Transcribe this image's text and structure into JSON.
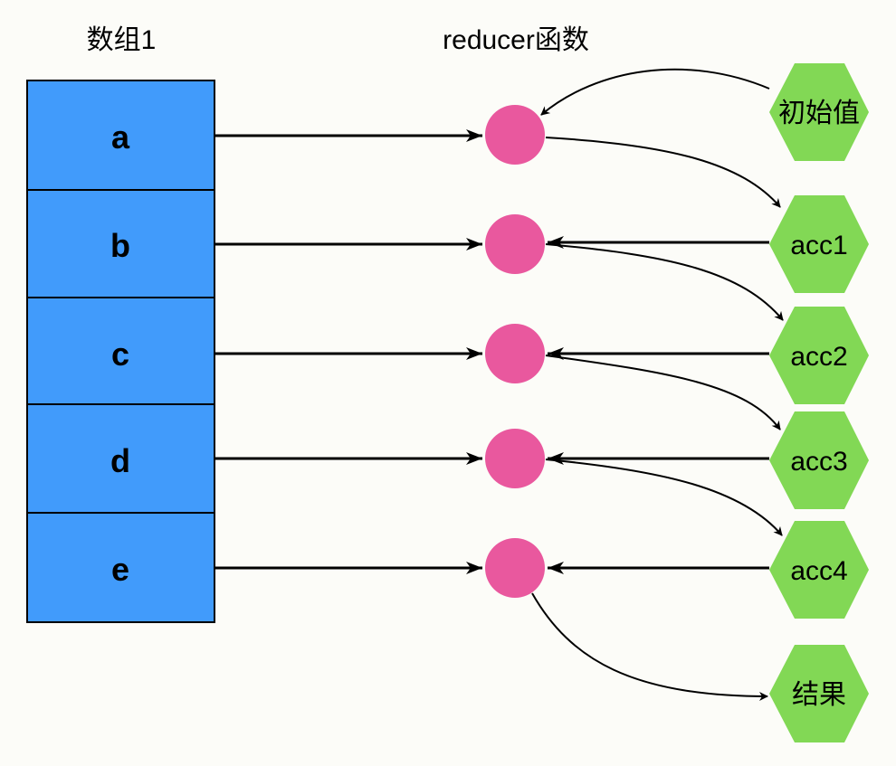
{
  "title_array": "数组1",
  "title_reducer": "reducer函数",
  "cells": [
    "a",
    "b",
    "c",
    "d",
    "e"
  ],
  "initial_value": "初始值",
  "accumulators": [
    "acc1",
    "acc2",
    "acc3",
    "acc4"
  ],
  "result": "结果",
  "colors": {
    "cell_fill": "#419bfb",
    "cell_stroke": "#000000",
    "node_fill": "#e9589e",
    "hex_fill": "#82d855"
  }
}
